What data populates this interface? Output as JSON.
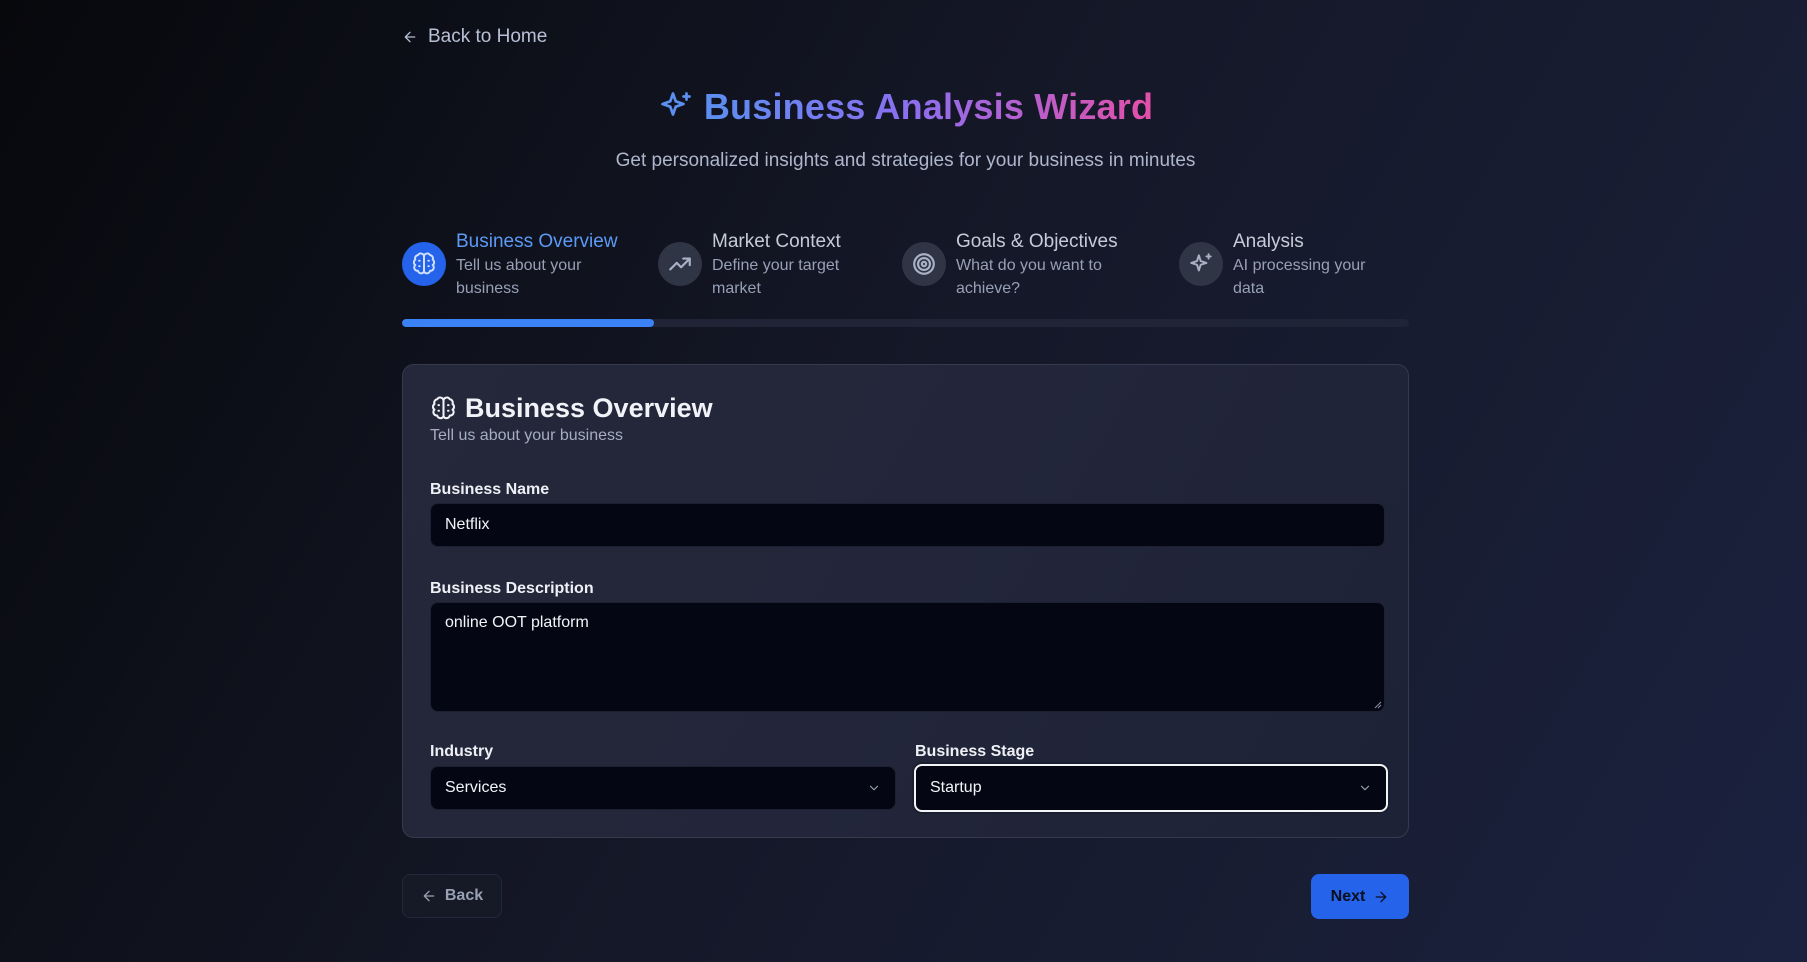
{
  "nav": {
    "back_home": "Back to Home"
  },
  "header": {
    "title": "Business Analysis Wizard",
    "subtitle": "Get personalized insights and strategies for your business in minutes"
  },
  "steps": [
    {
      "title": "Business Overview",
      "desc_line1": "Tell us about your",
      "desc_line2": "business",
      "icon": "brain-icon",
      "active": true
    },
    {
      "title": "Market Context",
      "desc_line1": "Define your target",
      "desc_line2": "market",
      "icon": "trending-up-icon",
      "active": false
    },
    {
      "title": "Goals & Objectives",
      "desc_line1": "What do you want to",
      "desc_line2": "achieve?",
      "icon": "target-icon",
      "active": false
    },
    {
      "title": "Analysis",
      "desc_line1": "AI processing your",
      "desc_line2": "data",
      "icon": "sparkles-icon",
      "active": false
    }
  ],
  "progress": {
    "fraction": 0.25
  },
  "card": {
    "title": "Business Overview",
    "subtitle": "Tell us about your business"
  },
  "form": {
    "business_name_label": "Business Name",
    "business_name_value": "Netflix",
    "description_label": "Business Description",
    "description_value": "online OOT platform",
    "industry_label": "Industry",
    "industry_value": "Services",
    "stage_label": "Business Stage",
    "stage_value": "Startup"
  },
  "buttons": {
    "back": "Back",
    "next": "Next"
  },
  "colors": {
    "accent": "#2563eb",
    "title_gradient": [
      "#5b8ff0",
      "#8a6ff0",
      "#e44fa8"
    ]
  }
}
